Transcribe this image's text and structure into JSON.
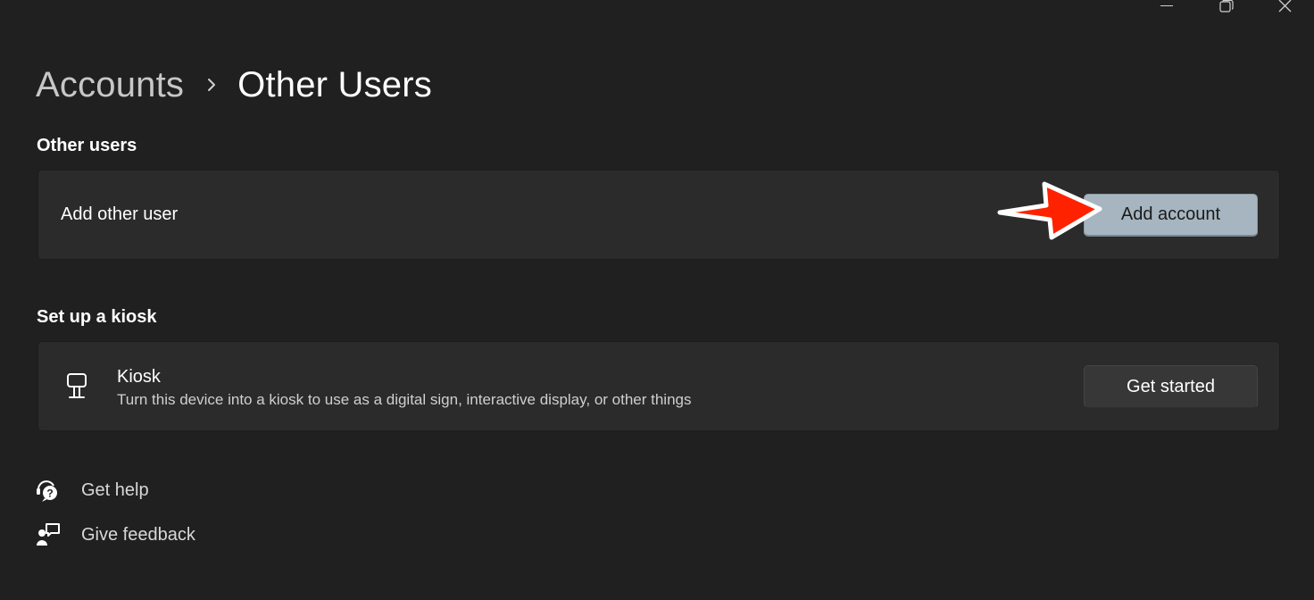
{
  "breadcrumb": {
    "parent": "Accounts",
    "current": "Other Users"
  },
  "sections": {
    "other_users": {
      "title": "Other users",
      "row_label": "Add other user",
      "button_label": "Add account"
    },
    "kiosk": {
      "title": "Set up a kiosk",
      "row_title": "Kiosk",
      "row_description": "Turn this device into a kiosk to use as a digital sign, interactive display, or other things",
      "button_label": "Get started"
    }
  },
  "help_links": {
    "get_help": "Get help",
    "give_feedback": "Give feedback"
  },
  "icons": {
    "chevron": "chevron-right-icon",
    "kiosk": "kiosk-icon",
    "help": "get-help-icon",
    "feedback": "feedback-icon",
    "annotation": "red-arrow-annotation"
  },
  "colors": {
    "background": "#202020",
    "card": "#2b2b2b",
    "accent_button": "#a6b5c0",
    "annotation_arrow": "#ff2200"
  }
}
